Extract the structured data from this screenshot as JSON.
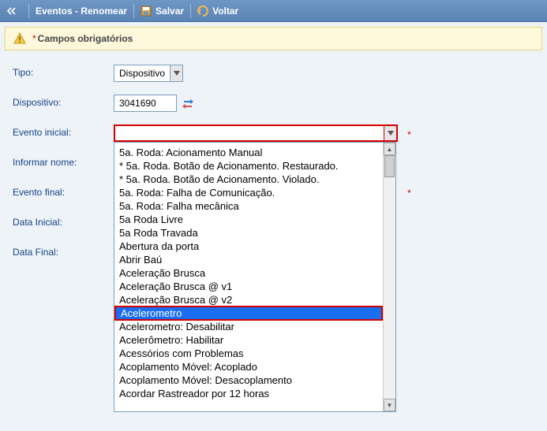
{
  "toolbar": {
    "title": "Eventos - Renomear",
    "save_label": "Salvar",
    "back_label": "Voltar"
  },
  "notice": {
    "message": "Campos obrigatórios"
  },
  "labels": {
    "tipo": "Tipo:",
    "dispositivo": "Dispositivo:",
    "evento_inicial": "Evento inicial:",
    "informar_nome": "Informar nome:",
    "evento_final": "Evento final:",
    "data_inicial": "Data Inicial:",
    "data_final": "Data Final:"
  },
  "fields": {
    "tipo_value": "Dispositivo",
    "dispositivo_value": "3041690",
    "evento_inicial_value": ""
  },
  "dropdown": {
    "selected_index": 12,
    "items": [
      "5a. Roda: Acionamento Manual",
      "* 5a. Roda. Botão de Acionamento. Restaurado.",
      "* 5a. Roda. Botão de Acionamento. Violado.",
      "5a. Roda: Falha de Comunicação.",
      "5a. Roda: Falha mecânica",
      "5a Roda Livre",
      "5a Roda Travada",
      "Abertura da porta",
      "Abrir Baú",
      "Aceleração Brusca",
      "Aceleração Brusca @ v1",
      "Aceleração Brusca @ v2",
      "Acelerometro",
      "Acelerometro: Desabilitar",
      "Acelerômetro: Habilitar",
      "Acessórios com Problemas",
      "Acoplamento Móvel: Acoplado",
      "Acoplamento Móvel: Desacoplamento",
      "Acordar Rastreador por 12 horas"
    ]
  }
}
